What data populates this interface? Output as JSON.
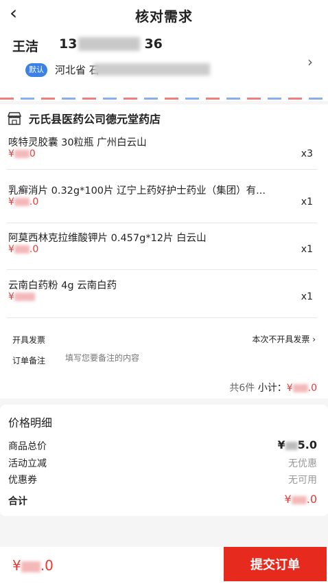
{
  "header": {
    "back_icon": "chevron-left-icon",
    "title": "核对需求"
  },
  "address": {
    "name": "王洁",
    "phone_prefix": "13",
    "phone_suffix": "36",
    "default_badge": "默认",
    "region": "河北省 石",
    "arrow_icon": "chevron-right-icon"
  },
  "store": {
    "icon": "store-icon",
    "name": "元氏县医药公司德元堂药店",
    "items": [
      {
        "name": "咳特灵胶囊 30粒瓶 广州白云山",
        "price_prefix": "¥",
        "price_suffix": "0",
        "qty": "x3"
      },
      {
        "name": "乳癣消片 0.32g*100片 辽宁上药好护士药业（集团）有...",
        "price_prefix": "¥",
        "price_suffix": ".0",
        "qty": "x1"
      },
      {
        "name": "阿莫西林克拉维酸钾片 0.457g*12片 白云山",
        "price_prefix": "¥",
        "price_suffix": ".0",
        "qty": "x1"
      },
      {
        "name": "云南白药粉 4g 云南白药",
        "price_prefix": "¥",
        "price_suffix": "",
        "qty": "x1"
      }
    ],
    "invoice_label": "开具发票",
    "invoice_value": "本次不开具发票",
    "remark_label": "订单备注",
    "remark_placeholder": "填写您要备注的内容",
    "count_text": "共6件",
    "subtotal_label": "小计：",
    "subtotal_prefix": "¥",
    "subtotal_suffix": ".0"
  },
  "price_detail": {
    "title": "价格明细",
    "goods_total_label": "商品总价",
    "goods_total_prefix": "¥",
    "goods_total_suffix": "5.0",
    "promo_label": "活动立减",
    "promo_value": "无优惠",
    "coupon_label": "优惠券",
    "coupon_value": "无可用",
    "total_label": "合计",
    "total_prefix": "¥",
    "total_suffix": ".0"
  },
  "bottom": {
    "total_prefix": "¥",
    "total_suffix": ".0",
    "submit_label": "提交订单"
  },
  "colors": {
    "accent": "#e62a1e",
    "price": "#e53935",
    "badge": "#3b82e6"
  }
}
